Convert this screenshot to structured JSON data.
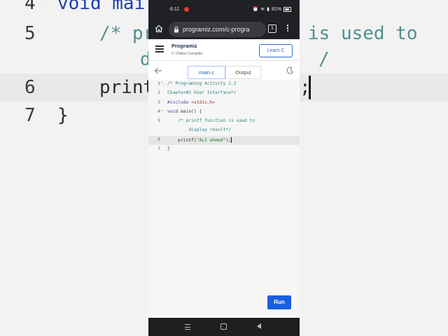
{
  "status_bar": {
    "time": "6:11",
    "battery": "81%"
  },
  "browser": {
    "url": "programiz.com/c-progra",
    "tabs_count": "1"
  },
  "site": {
    "brand": "Programiz",
    "brand_sub": "C Online Compiler",
    "learn_button": "Learn C"
  },
  "editor_toolbar": {
    "tab_file": "main.c",
    "tab_output": "Output"
  },
  "code_lines": [
    {
      "num": "1",
      "text": "/* Programing Activity 2.2"
    },
    {
      "num": "2",
      "text": "Chapter#2 User Interface*/"
    },
    {
      "num": "3",
      "text": "#include <stdio.h>"
    },
    {
      "num": "4",
      "text": "void main() {"
    },
    {
      "num": "5",
      "text": "    /* printf function is used to"
    },
    {
      "num": "",
      "text": "        display result*/"
    },
    {
      "num": "6",
      "text": "    printf(\"ALI ahmed\");"
    },
    {
      "num": "7",
      "text": "}"
    }
  ],
  "run_button": "Run",
  "background_zoom": {
    "line4_num": "4",
    "line4_text": "void mai",
    "line5_num": "5",
    "line5_left": "/* pr",
    "line5_right": "is used to",
    "line5_cont_left": "d",
    "line5_cont_right": "/",
    "line6_num": "6",
    "line6_left": "print",
    "line6_right": ";",
    "line7_num": "7",
    "line7_text": "}"
  },
  "colors": {
    "accent": "#1a5fe0",
    "browser_chrome": "#202124",
    "comment": "#2f7f7f",
    "keyword": "#1d47b5"
  }
}
